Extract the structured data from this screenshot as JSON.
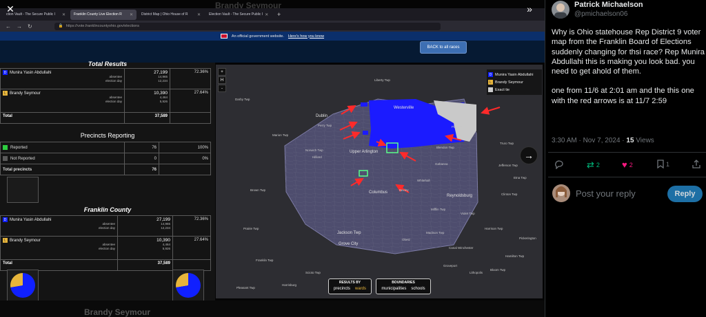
{
  "browser": {
    "tabs": [
      {
        "label": "ction Vault - The Secure Public I"
      },
      {
        "label": "Franklin County Live Election R"
      },
      {
        "label": "District Map | Ohio House of R"
      },
      {
        "label": "Election Vault - The Secure Public I"
      }
    ],
    "url": "https://vote.franklincountyohio.gov/elections",
    "gov_banner": "An official government website.",
    "gov_link": "Here's how you know"
  },
  "background_name": "Brandy Seymour",
  "back_button": "BACK to all races",
  "results": {
    "title": "Total Results",
    "candidates": [
      {
        "party": "D",
        "name": "Munira Yasin Abdullahi",
        "total": "27,199",
        "absentee": "14,965",
        "election_day": "12,234",
        "pct": "72.36%"
      },
      {
        "party": "L",
        "name": "Brandy Seymour",
        "total": "10,390",
        "absentee": "4,464",
        "election_day": "5,926",
        "pct": "27.64%"
      }
    ],
    "absentee_label": "absentee",
    "election_day_label": "election day",
    "total_label": "Total",
    "total_value": "37,589"
  },
  "precincts": {
    "title": "Precincts Reporting",
    "rows": [
      {
        "label": "Reported",
        "count": "76",
        "pct": "100%",
        "color": "#2ecc40"
      },
      {
        "label": "Not Reported",
        "count": "0",
        "pct": "0%",
        "color": "#5a5a5a"
      }
    ],
    "total_label": "Total precincts",
    "total_value": "76"
  },
  "county": {
    "title": "Franklin County",
    "candidates": [
      {
        "party": "D",
        "name": "Munira Yasin Abdullahi",
        "total": "27,199",
        "absentee": "14,965",
        "election_day": "12,234",
        "pct": "72.36%"
      },
      {
        "party": "L",
        "name": "Brandy Seymour",
        "total": "10,390",
        "absentee": "4,464",
        "election_day": "5,926",
        "pct": "27.64%"
      }
    ],
    "total_label": "Total",
    "total_value": "37,589"
  },
  "map": {
    "controls": [
      "+",
      "H",
      "-"
    ],
    "legend": [
      {
        "label": "Munira Yasin Abdullahi",
        "color": "#1020ff",
        "badge": "D"
      },
      {
        "label": "Brandy Seymour",
        "color": "#e7b53b",
        "badge": "L"
      },
      {
        "label": "Exact tie",
        "color": "#cccccc",
        "badge": ""
      }
    ],
    "places": [
      "Darby Twp",
      "Dublin",
      "Westerville",
      "Plain Twp",
      "Norwich Twp",
      "Upper Arlington",
      "Hilliard",
      "Columbus",
      "Reynoldsburg",
      "Jackson Twp",
      "Grove City",
      "Canal Winchester",
      "Madison Twp",
      "Violet Twp",
      "Pleasant Twp",
      "Franklin Twp",
      "Truro Twp",
      "Clinton Twp",
      "Mifflin Twp",
      "Jefferson Twp",
      "Blendon Twp",
      "Perry Twp",
      "Harrison Twp",
      "Prairie Twp",
      "Brown Twp",
      "Bloom Twp",
      "Liberty Twp",
      "Etna Twp",
      "Lithopolis",
      "Obetz",
      "Lockbourne",
      "Harrisburg",
      "Scioto Twp",
      "Pickerington",
      "Groveport",
      "Marion Twp",
      "Hamilton Twp",
      "Whitehall",
      "Gahanna",
      "Bexley"
    ],
    "toggle_results": {
      "title": "RESULTS BY",
      "options": [
        "precincts",
        "wards"
      ]
    },
    "toggle_boundaries": {
      "title": "BOUNDARIES",
      "options": [
        "municipalities",
        "schools"
      ]
    }
  },
  "tweet": {
    "name": "Patrick Michaelson",
    "handle": "@pmichaelson06",
    "text_1": "Why is Ohio statehouse Rep District 9 voter map from the Franklin Board of Elections suddenly changing for thsi race?  Rep Munira Abdullahi this is making you look bad.  you need to get ahold of them.",
    "text_2": "one from 11/6 at 2:01 am and the this one with the red arrows is at 11/7 2:59",
    "time": "3:30 AM · Nov 7, 2024 · ",
    "views": "15",
    "views_label": " Views",
    "retweets": "2",
    "likes": "2",
    "bookmarks": "1",
    "reply_placeholder": "Post your reply",
    "reply_button": "Reply"
  }
}
